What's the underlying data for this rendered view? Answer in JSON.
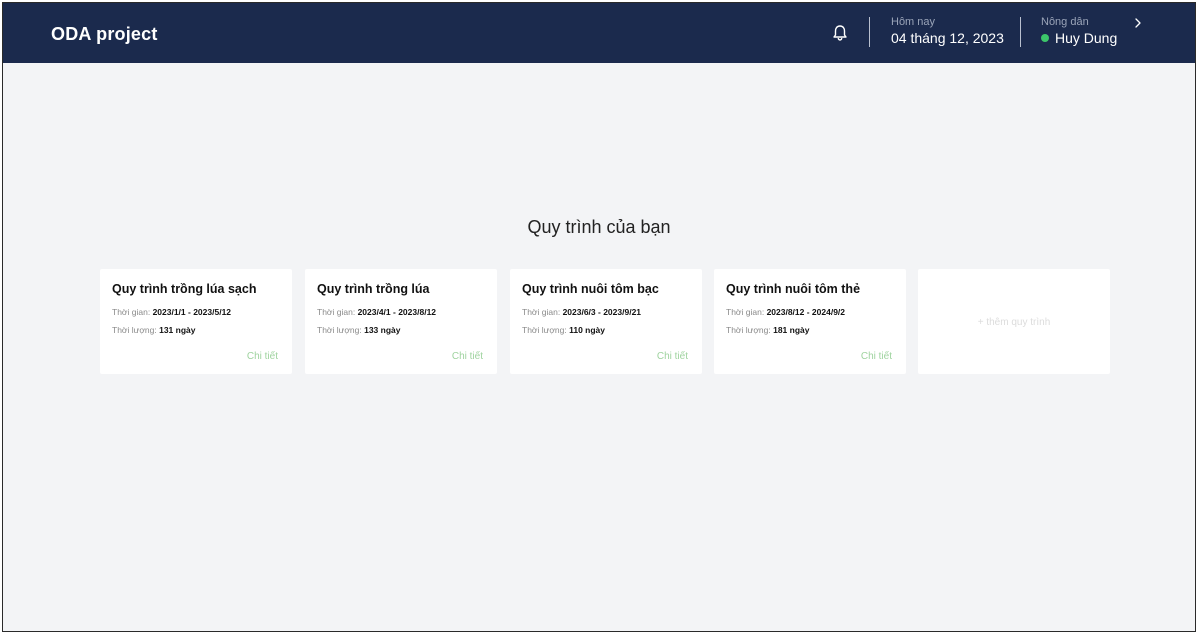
{
  "header": {
    "brand": "ODA project",
    "today_label": "Hôm nay",
    "today_value": "04 tháng 12, 2023",
    "role_label": "Nông dân",
    "user_name": "Huy Dung",
    "status_color": "#3cc66a",
    "icons": [
      "bell-icon",
      "chevron-right-icon"
    ]
  },
  "main": {
    "section_title": "Quy trình của bạn",
    "time_label": "Thời gian:",
    "duration_label": "Thời lượng:",
    "detail_label": "Chi tiết",
    "add_label": "+ thêm quy trình",
    "cards": [
      {
        "title": "Quy trình trồng lúa sạch",
        "time": "2023/1/1 - 2023/5/12",
        "duration": "131 ngày"
      },
      {
        "title": "Quy trình trồng lúa",
        "time": "2023/4/1 - 2023/8/12",
        "duration": "133 ngày"
      },
      {
        "title": "Quy trình nuôi tôm bạc",
        "time": "2023/6/3 - 2023/9/21",
        "duration": "110 ngày"
      },
      {
        "title": "Quy trình nuôi tôm thẻ",
        "time": "2023/8/12 - 2024/9/2",
        "duration": "181 ngày"
      }
    ]
  }
}
